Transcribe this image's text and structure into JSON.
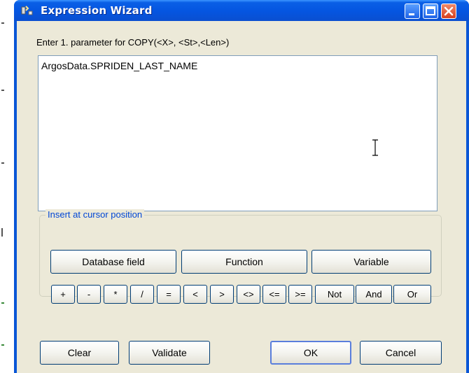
{
  "window": {
    "title": "Expression Wizard"
  },
  "prompt_text": "Enter 1. parameter for COPY(<X>, <St>,<Len>)",
  "expression_value": "ArgosData.SPRIDEN_LAST_NAME",
  "insert_group": {
    "label": "Insert at cursor position",
    "buttons": {
      "database_field": "Database field",
      "function": "Function",
      "variable": "Variable"
    },
    "operators": [
      "+",
      "-",
      "*",
      "/",
      "=",
      "<",
      ">",
      "<>",
      "<=",
      ">=",
      "Not",
      "And",
      "Or"
    ]
  },
  "footer": {
    "clear": "Clear",
    "validate": "Validate",
    "ok": "OK",
    "cancel": "Cancel"
  }
}
